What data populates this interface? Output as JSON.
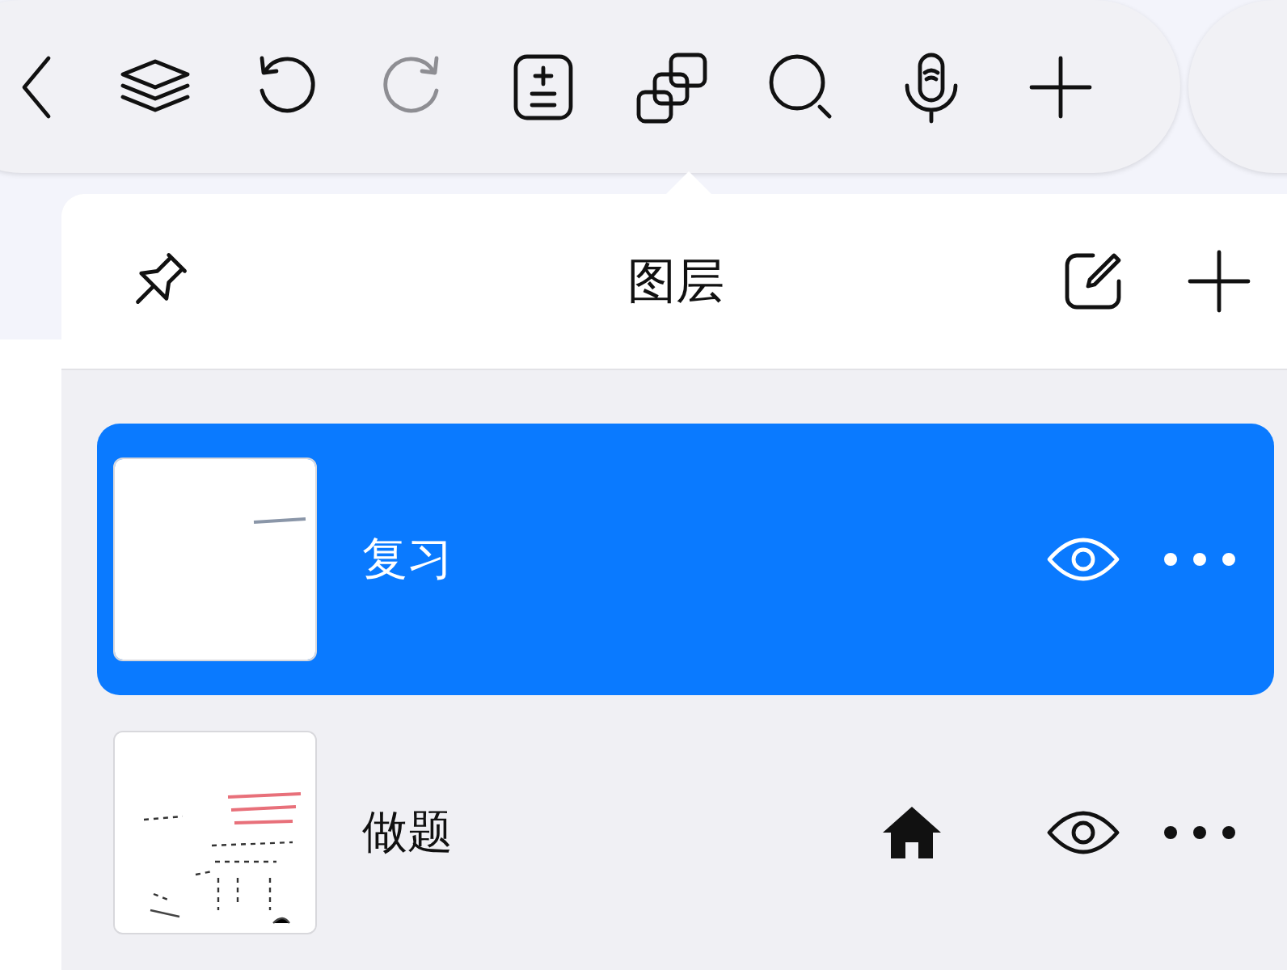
{
  "toolbar": {
    "tools": [
      {
        "kind": "back",
        "disabled": false
      },
      {
        "kind": "layers",
        "disabled": false
      },
      {
        "kind": "undo",
        "disabled": false
      },
      {
        "kind": "redo",
        "disabled": true
      },
      {
        "kind": "calc",
        "disabled": false
      },
      {
        "kind": "copies",
        "disabled": false
      },
      {
        "kind": "search",
        "disabled": false
      },
      {
        "kind": "mic",
        "disabled": false
      },
      {
        "kind": "add",
        "disabled": false
      }
    ]
  },
  "panel": {
    "title": "图层",
    "layers": [
      {
        "name": "复习",
        "selected": true,
        "home": false,
        "visible": true
      },
      {
        "name": "做题",
        "selected": false,
        "home": true,
        "visible": true
      }
    ]
  }
}
